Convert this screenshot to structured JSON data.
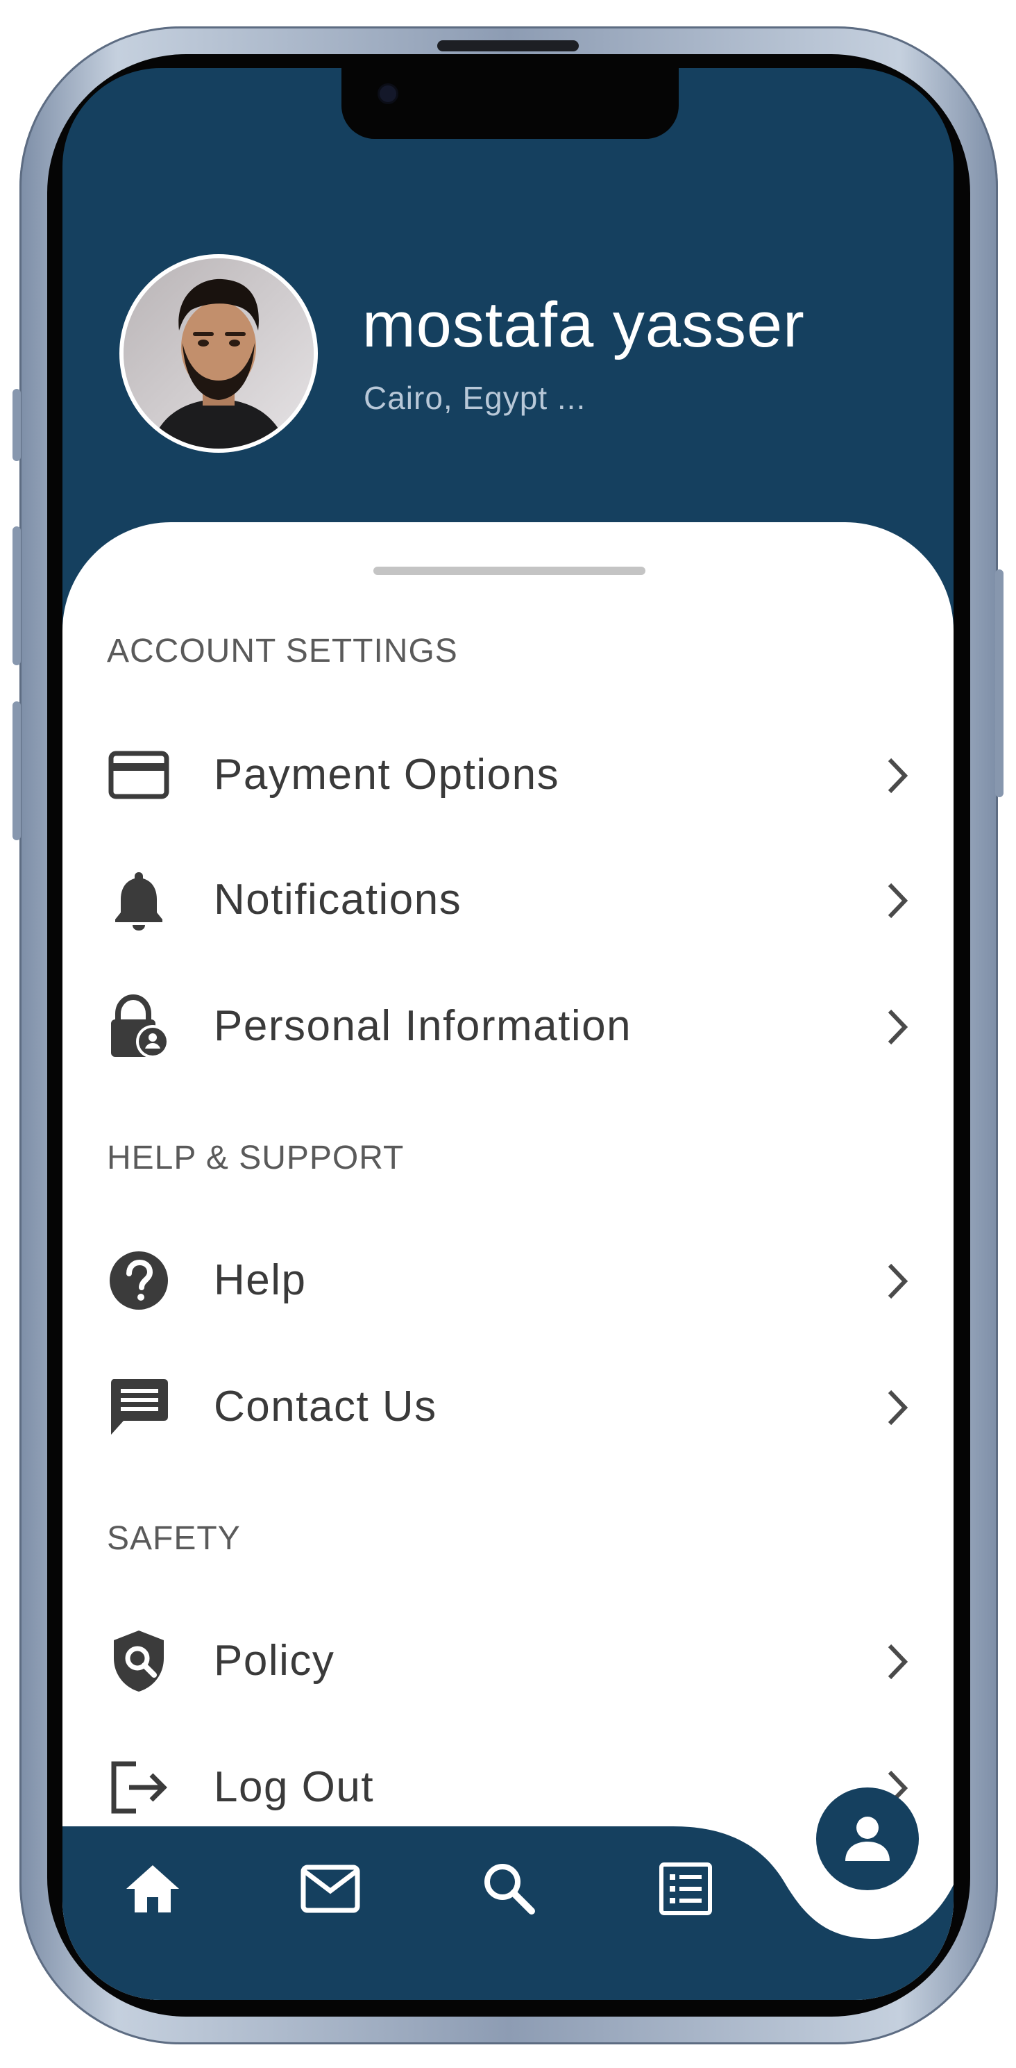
{
  "colors": {
    "header_bg": "#15405f",
    "sheet_bg": "#ffffff",
    "text_primary": "#3a3a3a",
    "section_title": "#5a5a5a",
    "chevron": "#4a4a4a"
  },
  "profile": {
    "name": "mostafa yasser",
    "location": "Cairo, Egypt ..."
  },
  "sections": {
    "account": {
      "title": "ACCOUNT SETTINGS",
      "items": [
        {
          "label": "Payment Options",
          "icon": "credit-card-icon"
        },
        {
          "label": "Notifications",
          "icon": "bell-icon"
        },
        {
          "label": "Personal Information",
          "icon": "lock-person-icon"
        }
      ]
    },
    "help": {
      "title": "HELP & SUPPORT",
      "items": [
        {
          "label": "Help",
          "icon": "help-circle-icon"
        },
        {
          "label": "Contact Us",
          "icon": "message-icon"
        }
      ]
    },
    "safety": {
      "title": "SAFETY",
      "items": [
        {
          "label": "Policy",
          "icon": "shield-search-icon"
        },
        {
          "label": "Log Out",
          "icon": "logout-icon"
        }
      ]
    }
  },
  "bottom_nav": {
    "items": [
      {
        "icon": "home-icon"
      },
      {
        "icon": "mail-icon"
      },
      {
        "icon": "search-icon"
      },
      {
        "icon": "list-icon"
      }
    ],
    "active": {
      "icon": "person-icon"
    }
  }
}
